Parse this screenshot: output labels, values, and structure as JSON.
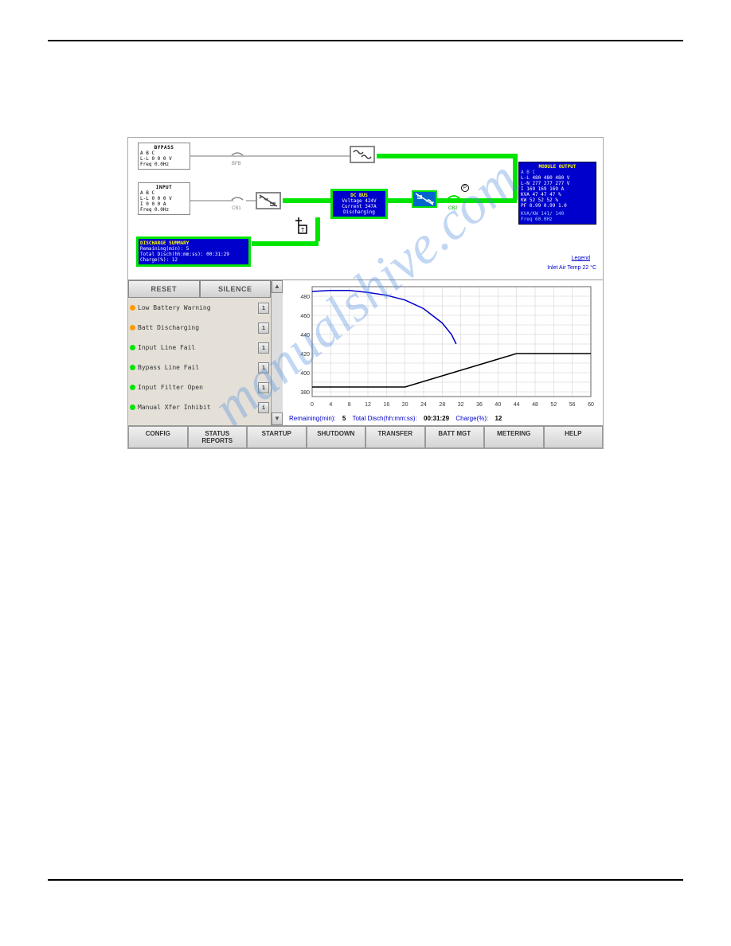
{
  "bypass": {
    "title": "BYPASS",
    "cols": "A    B    C",
    "ll": "L-L   0    0    0  V",
    "freq": "Freq  0.0Hz"
  },
  "input": {
    "title": "INPUT",
    "cols": "A    B    C",
    "ll": "L-L   0    0    0  V",
    "i": "I     0    0    0  A",
    "freq": "Freq  0.0Hz"
  },
  "discharge": {
    "title": "DISCHARGE SUMMARY",
    "remaining": "Remaining(min):       5",
    "total": "Total Disch(hh:mm:ss): 00:31:29",
    "charge": "Charge(%):           12"
  },
  "dcbus": {
    "title": "DC BUS",
    "voltage": "Voltage  424V",
    "current": "Current  347A",
    "status": "Discharging"
  },
  "output": {
    "title": "MODULE OUTPUT",
    "header": "       A    B    C",
    "ll": "L-L  480  480  480 V",
    "ln": "L-N  277  277  277 V",
    "i": "I    169  169  169 A",
    "kva": "KVA   47   47   47 %",
    "kw": "KW    52   52   52 %",
    "pf": "PF  0.99 0.99 1.0",
    "kvakw": "KVA/KW   141/ 140",
    "freq": "Freq     60.0Hz"
  },
  "legend_text": "Legend",
  "inlet_text": "Inlet Air Temp 22 °C",
  "labels": {
    "bfb": "BFB",
    "cb1": "CB1",
    "cb2": "CB2"
  },
  "alarm_buttons": {
    "reset": "RESET",
    "silence": "SILENCE"
  },
  "alarms": [
    {
      "color": "orange",
      "text": "Low Battery Warning",
      "val": "1"
    },
    {
      "color": "orange",
      "text": "Batt Discharging",
      "val": "1"
    },
    {
      "color": "green",
      "text": "Input Line Fail",
      "val": "1"
    },
    {
      "color": "green",
      "text": "Bypass Line Fail",
      "val": "1"
    },
    {
      "color": "green",
      "text": "Input Filter Open",
      "val": "1"
    },
    {
      "color": "green",
      "text": "Manual Xfer Inhibit",
      "val": "i"
    }
  ],
  "chart_stats": {
    "remaining_label": "Remaining(min):",
    "remaining": "5",
    "total_label": "Total Disch(hh:mm:ss):",
    "total": "00:31:29",
    "charge_label": "Charge(%):",
    "charge": "12"
  },
  "tabs": [
    "CONFIG",
    "STATUS REPORTS",
    "STARTUP",
    "SHUTDOWN",
    "TRANSFER",
    "BATT MGT",
    "METERING",
    "HELP"
  ],
  "watermark": "manualshive.com",
  "chart_data": {
    "type": "line",
    "xlabel": "",
    "ylabel": "",
    "x_ticks": [
      0,
      4,
      8,
      12,
      16,
      20,
      24,
      28,
      32,
      36,
      40,
      44,
      48,
      52,
      56,
      60
    ],
    "y_ticks": [
      380,
      400,
      420,
      440,
      460,
      480
    ],
    "ylim": [
      375,
      490
    ],
    "xlim": [
      0,
      60
    ],
    "series": [
      {
        "name": "blue",
        "color": "#0000cc",
        "points": [
          [
            0,
            485
          ],
          [
            4,
            486
          ],
          [
            8,
            486
          ],
          [
            12,
            484
          ],
          [
            16,
            481
          ],
          [
            20,
            476
          ],
          [
            24,
            467
          ],
          [
            28,
            452
          ],
          [
            30,
            440
          ],
          [
            31,
            430
          ]
        ]
      },
      {
        "name": "black",
        "color": "#000",
        "points": [
          [
            0,
            385
          ],
          [
            20,
            385
          ],
          [
            44,
            420
          ],
          [
            60,
            420
          ]
        ]
      }
    ]
  }
}
